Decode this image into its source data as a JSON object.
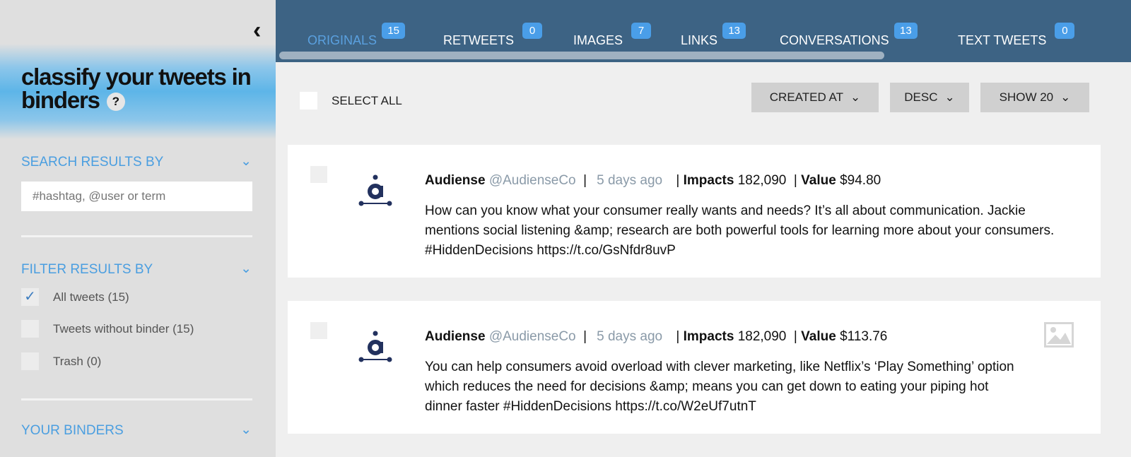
{
  "sidebar": {
    "title": "classify your tweets in binders",
    "help": "?",
    "search_section": "SEARCH RESULTS BY",
    "search_placeholder": "#hashtag, @user or term",
    "filter_section": "FILTER RESULTS BY",
    "filters": [
      {
        "label": "All tweets (15)",
        "checked": true
      },
      {
        "label": "Tweets without binder (15)",
        "checked": false
      },
      {
        "label": "Trash (0)",
        "checked": false
      }
    ],
    "binders_section": "YOUR BINDERS"
  },
  "tabs": [
    {
      "label": "ORIGINALS",
      "count": "15",
      "active": true
    },
    {
      "label": "RETWEETS",
      "count": "0"
    },
    {
      "label": "IMAGES",
      "count": "7"
    },
    {
      "label": "LINKS",
      "count": "13"
    },
    {
      "label": "CONVERSATIONS",
      "count": "13"
    },
    {
      "label": "TEXT TWEETS",
      "count": "0"
    }
  ],
  "toolbar": {
    "select_all": "SELECT ALL",
    "sort_by": "CREATED AT",
    "order": "DESC",
    "show": "SHOW 20"
  },
  "tweets": [
    {
      "name": "Audiense",
      "handle": "@AudienseCo",
      "time": "5 days ago",
      "impacts_label": "Impacts",
      "impacts": "182,090",
      "value_label": "Value",
      "value": "$94.80",
      "text": "How can you know what your consumer really wants and needs? It’s all about communication. Jackie mentions social listening &amp; research are both powerful tools for learning more about your consumers. #HiddenDecisions https://t.co/GsNfdr8uvP"
    },
    {
      "name": "Audiense",
      "handle": "@AudienseCo",
      "time": "5 days ago",
      "impacts_label": "Impacts",
      "impacts": "182,090",
      "value_label": "Value",
      "value": "$113.76",
      "text": "You can help consumers avoid overload with clever marketing, like Netflix’s ‘Play Something’ option which reduces the need for decisions &amp; means you can get down to eating your piping hot dinner faster #HiddenDecisions https://t.co/W2eUf7utnT",
      "has_image": true
    }
  ],
  "colors": {
    "topbar": "#3d6384",
    "accent": "#4a9ee0",
    "badge": "#4a9ee8"
  }
}
